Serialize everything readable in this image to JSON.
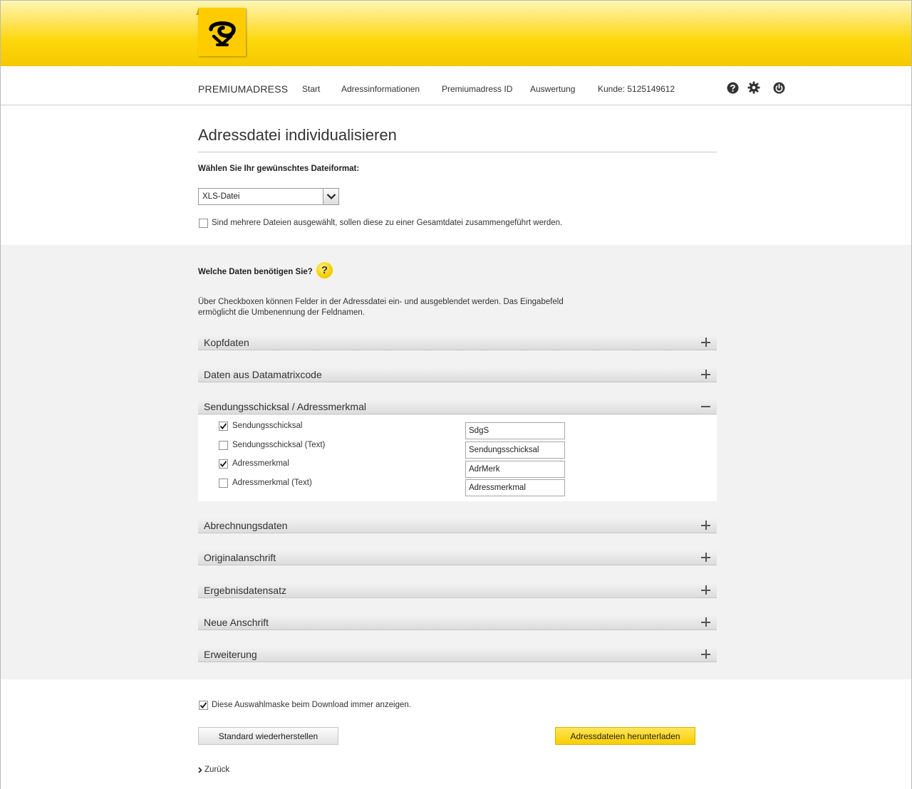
{
  "header": {
    "brand": "PREMIUMADRESS",
    "nav": [
      "Start",
      "Adressinformationen",
      "Premiumadress ID",
      "Auswertung",
      "Kunde: 5125149612"
    ]
  },
  "page": {
    "title": "Adressdatei individualisieren",
    "format_label": "Wählen Sie Ihr gewünschtes Dateiformat:",
    "format_value": "XLS-Datei",
    "merge_label": "Sind mehrere Dateien ausgewählt, sollen diese zu einer Gesamtdatei zusammengeführt werden.",
    "merge_checked": false
  },
  "data_section": {
    "heading": "Welche Daten benötigen Sie?",
    "help_glyph": "?",
    "description": "Über Checkboxen können Felder in der Adressdatei ein- und ausgeblendet werden. Das Eingabefeld ermöglicht die Umbenennung der Feldnamen."
  },
  "accordions": [
    {
      "title": "Kopfdaten",
      "expanded": false
    },
    {
      "title": "Daten aus Datamatrixcode",
      "expanded": false
    },
    {
      "title": "Sendungsschicksal / Adressmerkmal",
      "expanded": true
    },
    {
      "title": "Abrechnungsdaten",
      "expanded": false
    },
    {
      "title": "Originalanschrift",
      "expanded": false
    },
    {
      "title": "Ergebnisdatensatz",
      "expanded": false
    },
    {
      "title": "Neue Anschrift",
      "expanded": false
    },
    {
      "title": "Erweiterung",
      "expanded": false
    }
  ],
  "fields": [
    {
      "label": "Sendungsschicksal",
      "checked": true,
      "value": "SdgS"
    },
    {
      "label": "Sendungsschicksal (Text)",
      "checked": false,
      "value": "Sendungsschicksal"
    },
    {
      "label": "Adressmerkmal",
      "checked": true,
      "value": "AdrMerk"
    },
    {
      "label": "Adressmerkmal (Text)",
      "checked": false,
      "value": "Adressmerkmal"
    }
  ],
  "footer": {
    "always_show_label": "Diese Auswahlmaske beim Download immer anzeigen.",
    "always_show_checked": true,
    "reset_button": "Standard wiederherstellen",
    "download_button": "Adressdateien herunterladen",
    "back_link": "Zurück"
  },
  "colors": {
    "brand_yellow": "#fecc00",
    "background_gray": "#f2f2f2"
  }
}
